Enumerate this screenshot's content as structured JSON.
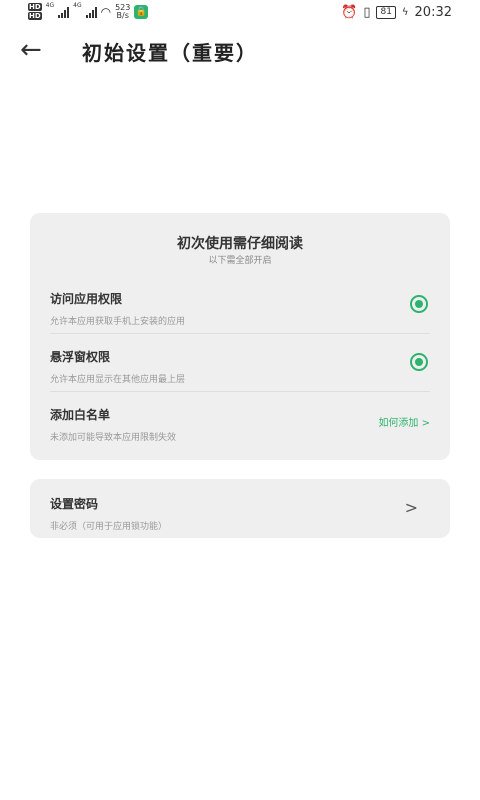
{
  "status_bar": {
    "hd1": "HD",
    "hd2": "HD",
    "net1": "4G",
    "net2": "4G",
    "speed_value": "523",
    "speed_unit": "B/s",
    "battery": "81",
    "time": "20:32"
  },
  "header": {
    "title": "初始设置（重要）"
  },
  "permissions_card": {
    "title": "初次使用需仔细阅读",
    "subtitle": "以下需全部开启",
    "items": [
      {
        "title": "访问应用权限",
        "desc": "允许本应用获取手机上安装的应用",
        "enabled": true
      },
      {
        "title": "悬浮窗权限",
        "desc": "允许本应用显示在其他应用最上层",
        "enabled": true
      },
      {
        "title": "添加白名单",
        "desc": "未添加可能导致本应用限制失效",
        "link": "如何添加 >"
      }
    ]
  },
  "password_card": {
    "title": "设置密码",
    "desc": "非必须（可用于应用锁功能）"
  },
  "colors": {
    "accent": "#2db36d",
    "card_bg": "#efefef"
  }
}
